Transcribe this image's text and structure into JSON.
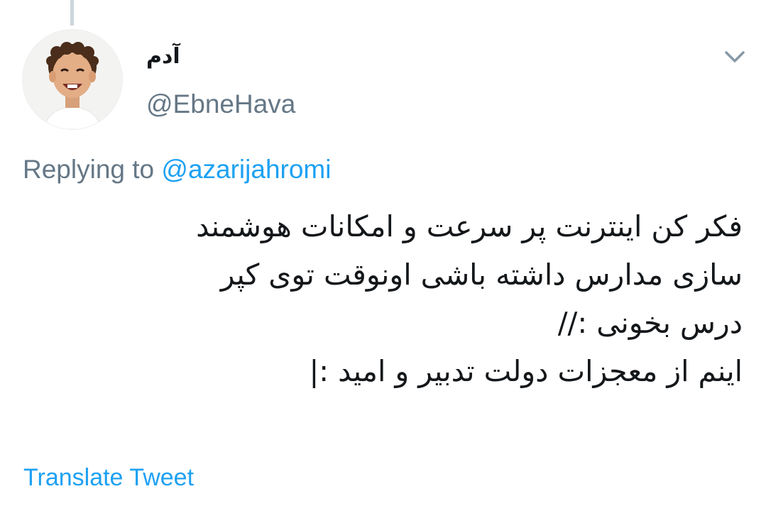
{
  "tweet": {
    "display_name": "آدم",
    "handle": "@EbneHava",
    "avatar_icon": "child-avatar-photo",
    "menu_icon": "chevron-down-icon",
    "replying_prefix": "Replying to ",
    "replying_to": "@azarijahromi",
    "text_lines": [
      "فکر کن اینترنت پر سرعت و امکانات هوشمند",
      "سازی مدارس داشته باشی اونوقت توی کپر",
      "درس بخونی ://",
      "اینم از معجزات دولت تدبیر و امید :|"
    ],
    "translate_label": "Translate Tweet"
  },
  "colors": {
    "text": "#14171a",
    "secondary": "#657786",
    "link": "#1da1f2",
    "thread_line": "#ccd6dd"
  }
}
